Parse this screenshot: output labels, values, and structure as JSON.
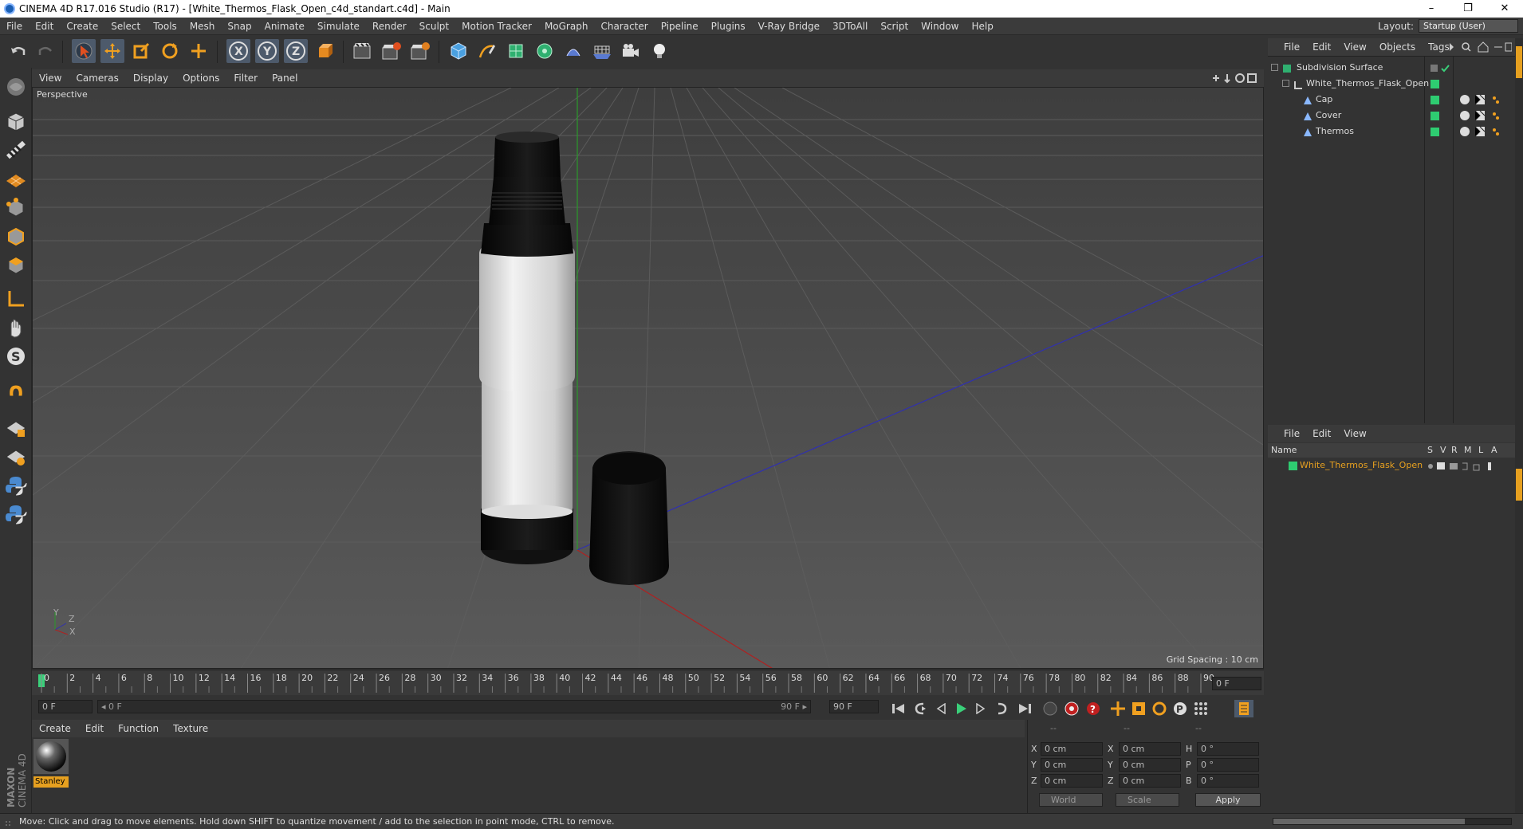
{
  "window": {
    "title": "CINEMA 4D R17.016 Studio (R17) - [White_Thermos_Flask_Open_c4d_standart.c4d] - Main",
    "controls": [
      "–",
      "❐",
      "✕"
    ]
  },
  "menu": [
    "File",
    "Edit",
    "Create",
    "Select",
    "Tools",
    "Mesh",
    "Snap",
    "Animate",
    "Simulate",
    "Render",
    "Sculpt",
    "Motion Tracker",
    "MoGraph",
    "Character",
    "Pipeline",
    "Plugins",
    "V-Ray Bridge",
    "3DToAll",
    "Script",
    "Window",
    "Help"
  ],
  "layout": {
    "label": "Layout:",
    "value": "Startup (User)"
  },
  "viewport": {
    "menu": [
      "View",
      "Cameras",
      "Display",
      "Options",
      "Filter",
      "Panel"
    ],
    "label": "Perspective",
    "grid_spacing": "Grid Spacing : 10 cm",
    "axis_labels": [
      "Y",
      "Z",
      "X"
    ]
  },
  "timeline": {
    "ticks": [
      "0",
      "2",
      "4",
      "6",
      "8",
      "10",
      "12",
      "14",
      "16",
      "18",
      "20",
      "22",
      "24",
      "26",
      "28",
      "30",
      "32",
      "34",
      "36",
      "38",
      "40",
      "42",
      "44",
      "46",
      "48",
      "50",
      "52",
      "54",
      "56",
      "58",
      "60",
      "62",
      "64",
      "66",
      "68",
      "70",
      "72",
      "74",
      "76",
      "78",
      "80",
      "82",
      "84",
      "86",
      "88",
      "90"
    ],
    "current_frame": "0 F",
    "start_field": "0 F",
    "range_start": "◂ 0 F",
    "range_end": "90 F ▸",
    "end_field": "90 F"
  },
  "material_manager": {
    "menu": [
      "Create",
      "Edit",
      "Function",
      "Texture"
    ],
    "materials": [
      {
        "name": "Stanley"
      }
    ]
  },
  "coordinates": {
    "headers": [
      "--",
      "--",
      "--"
    ],
    "rows": [
      {
        "a": "X",
        "av": "0 cm",
        "b": "X",
        "bv": "0 cm",
        "c": "H",
        "cv": "0 °"
      },
      {
        "a": "Y",
        "av": "0 cm",
        "b": "Y",
        "bv": "0 cm",
        "c": "P",
        "cv": "0 °"
      },
      {
        "a": "Z",
        "av": "0 cm",
        "b": "Z",
        "bv": "0 cm",
        "c": "B",
        "cv": "0 °"
      }
    ],
    "mode1": "World",
    "mode2": "Scale",
    "apply": "Apply"
  },
  "object_manager": {
    "menu": [
      "File",
      "Edit",
      "View",
      "Objects",
      "Tags"
    ],
    "objects": [
      {
        "name": "Subdivision Surface",
        "indent": 0
      },
      {
        "name": "White_Thermos_Flask_Open",
        "indent": 1
      },
      {
        "name": "Cap",
        "indent": 2
      },
      {
        "name": "Cover",
        "indent": 2
      },
      {
        "name": "Thermos",
        "indent": 2
      }
    ]
  },
  "layer_manager": {
    "menu": [
      "File",
      "Edit",
      "View"
    ],
    "columns": {
      "name": "Name",
      "flags": [
        "S",
        "V",
        "R",
        "M",
        "L",
        "A"
      ]
    },
    "rows": [
      {
        "name": "White_Thermos_Flask_Open",
        "color": "#2ecc71"
      }
    ]
  },
  "colors": {
    "accent": "#e6a020",
    "layer_green": "#2ecc71",
    "active_tool": "#4d5a6b"
  },
  "status": "Move: Click and drag to move elements. Hold down SHIFT to quantize movement / add to the selection in point mode, CTRL to remove.",
  "logo": "MAXON CINEMA 4D"
}
